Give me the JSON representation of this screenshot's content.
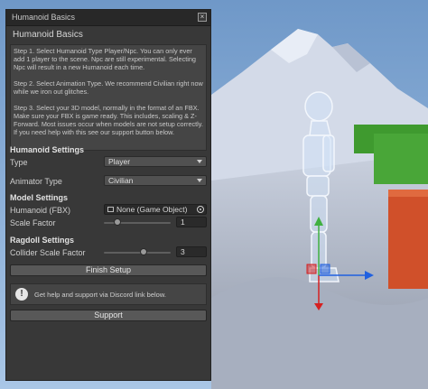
{
  "window": {
    "title": "Humanoid Basics",
    "close_label": "×",
    "heading": "Humanoid Basics"
  },
  "help": {
    "step1": "Step 1. Select Humanoid Type Player/Npc. You can only ever add 1 player to the scene. Npc are still experimental. Selecting Npc will result in a new Humanoid each time.",
    "step2": "Step 2. Select Animation Type. We recommend Civilian right now while we iron out glitches.",
    "step3": "Step 3. Select your 3D model, normally in the format of an FBX. Make sure your FBX is game ready. This includes, scaling & Z-Forward. Most issues occur when models are not setup correctly. If you need help with this see our support button below."
  },
  "humanoid_settings": {
    "heading": "Humanoid Settings",
    "type_label": "Type",
    "type_value": "Player",
    "animator_label": "Animator Type",
    "animator_value": "Civilian"
  },
  "model_settings": {
    "heading": "Model Settings",
    "humanoid_label": "Humanoid (FBX)",
    "humanoid_value": "None (Game Object)",
    "scale_label": "Scale Factor",
    "scale_value": "1",
    "scale_slider_fraction": 0.2
  },
  "ragdoll_settings": {
    "heading": "Ragdoll Settings",
    "collider_label": "Collider Scale Factor",
    "collider_value": "3",
    "collider_slider_fraction": 0.6
  },
  "actions": {
    "finish_label": "Finish Setup",
    "info_text": "Get help and support via Discord link below.",
    "support_label": "Support"
  },
  "colors": {
    "editor_bg": "#383838",
    "sky": "#8ab0d8",
    "mountain": "#cfd6e6",
    "green_block": "#3f9a2f",
    "orange_block": "#d0502a",
    "gizmo_x": "#d62020",
    "gizmo_y": "#2060e0",
    "gizmo_z": "#40b040"
  },
  "icons": [
    "close-icon",
    "dropdown-arrow-icon",
    "object-picker-icon",
    "info-icon",
    "move-gizmo-icon"
  ]
}
